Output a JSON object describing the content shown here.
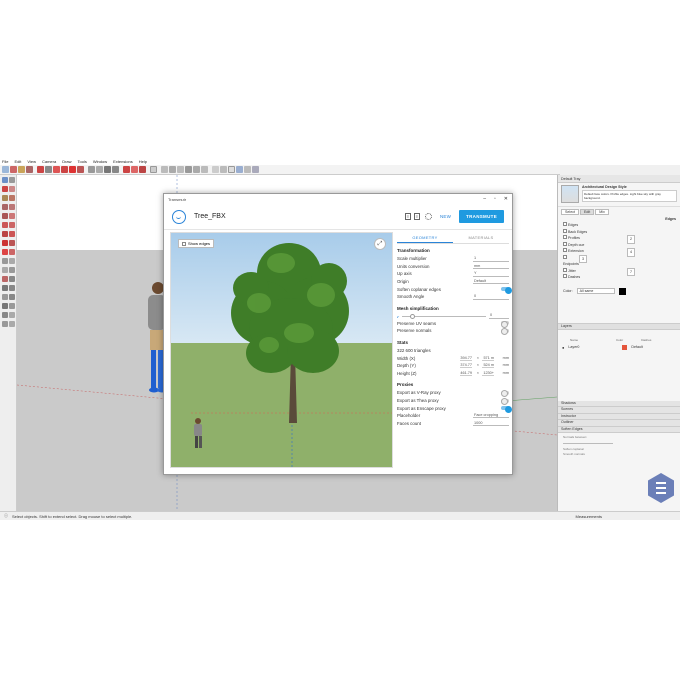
{
  "menubar": [
    "File",
    "Edit",
    "View",
    "Camera",
    "Draw",
    "Tools",
    "Window",
    "Extensions",
    "Help"
  ],
  "statusbar": {
    "text": "Select objects. Shift to extend select. Drag mouse to select multiple.",
    "measurements": "Measurements"
  },
  "rightpanel": {
    "tray_title": "Default Tray",
    "style_name": "Architectural Design Style",
    "style_desc": "Default face colors. Profile edges. Light blue sky with gray background.",
    "tabs": [
      "Select",
      "Edit",
      "Mix"
    ],
    "edges_label": "Edges",
    "edge_settings": [
      "Edges",
      "Back Edges",
      "Profiles",
      "Depth cue",
      "Extension",
      "Endpoints",
      "Jitter",
      "Dashes"
    ],
    "edge_values": [
      "2",
      "4",
      "3",
      "7"
    ],
    "color_label": "Color:",
    "color_value": "All same",
    "layers_title": "Layers",
    "layers_cols": [
      "Name",
      "Color",
      "Dashes"
    ],
    "layer_name": "Layer0",
    "layer_dash": "Default",
    "collapsed_panels": [
      "Shadows",
      "Scenes",
      "Instructor",
      "Outliner",
      "Soften Edges"
    ],
    "soften_options": [
      "Normals between:",
      "Soften coplanar",
      "Smooth normals"
    ]
  },
  "dialog": {
    "app_title": "Transmutr",
    "asset_name": "Tree_FBX",
    "new_label": "NEW",
    "transmute_label": "TRANSMUTE",
    "show_edges": "Show edges",
    "tabs": [
      "GEOMETRY",
      "MATERIALS"
    ],
    "transformation": {
      "title": "Transformation",
      "rows": [
        {
          "label": "Scale multiplier",
          "value": "1"
        },
        {
          "label": "Units conversion",
          "value": "mm"
        },
        {
          "label": "Up axis",
          "value": "Y"
        },
        {
          "label": "Origin",
          "value": "Default"
        }
      ],
      "soften_label": "Soften coplanar edges",
      "smooth_label": "Smooth Angle",
      "smooth_value": "0"
    },
    "mesh": {
      "title": "Mesh simplification",
      "slider_value": "0",
      "preserve_uv": "Preserve UV seams",
      "preserve_normals": "Preserve normals"
    },
    "stats": {
      "title": "Stats",
      "triangles": "322 600 triangles",
      "width_label": "Width (X)",
      "width_vals": [
        "394.77",
        "×",
        "571 m",
        "mm"
      ],
      "depth_label": "Depth (Y)",
      "depth_vals": [
        "374.77",
        "×",
        "524 m",
        "mm"
      ],
      "height_label": "Height (Z)",
      "height_vals": [
        "461.79",
        "×",
        "1230+",
        "mm"
      ]
    },
    "proxies": {
      "title": "Proxies",
      "vray": "Export as V-Ray proxy",
      "thea": "Export as Thea proxy",
      "enscape": "Export as Enscape proxy",
      "placeholder_label": "Placeholder",
      "placeholder_value": "Face cropping",
      "faces_label": "Faces count",
      "faces_value": "1000"
    }
  },
  "colors": {
    "accent": "#1f9ae0",
    "layer_color": "#e4553c"
  }
}
